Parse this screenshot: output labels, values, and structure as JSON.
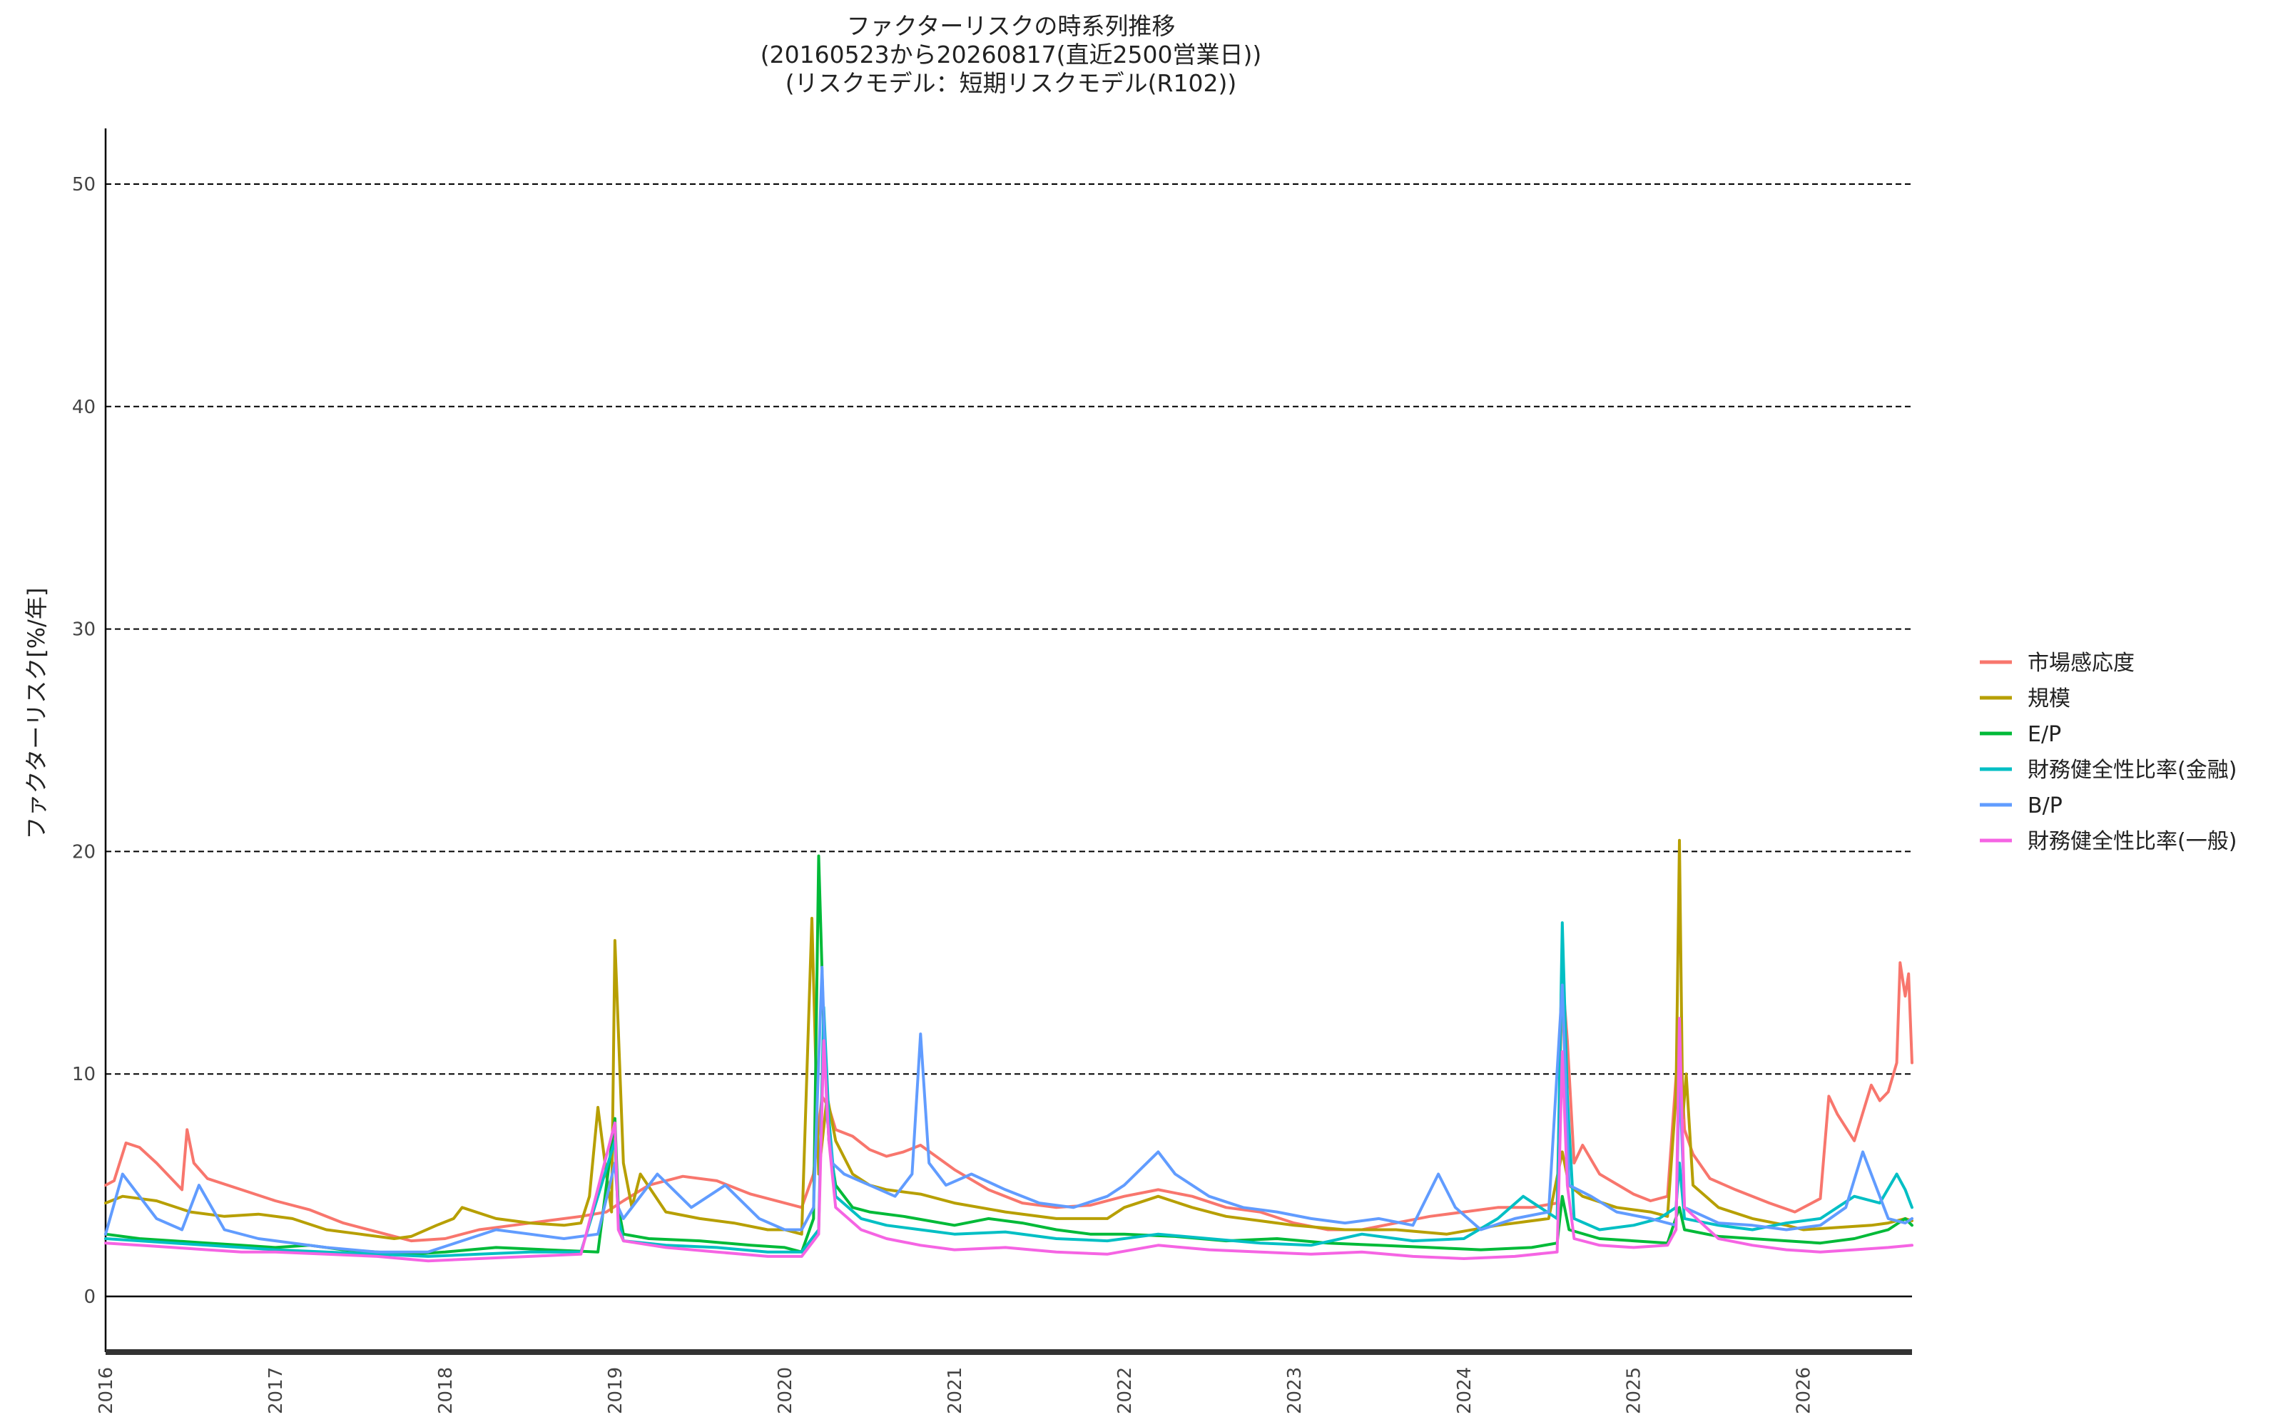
{
  "chart_data": {
    "type": "line",
    "title": [
      "ファクターリスクの時系列推移",
      "(20160523から20260817(直近2500営業日))",
      "(リスクモデル：短期リスクモデル(R102))"
    ],
    "ylabel": "ファクターリスク[%/年]",
    "xlabel": "",
    "xlim": [
      2016.0,
      2026.64
    ],
    "ylim": [
      -2.5,
      52.5
    ],
    "y_ticks": [
      0,
      10,
      20,
      30,
      40,
      50
    ],
    "x_ticks": [
      "2016",
      "2017",
      "2018",
      "2019",
      "2020",
      "2021",
      "2022",
      "2023",
      "2024",
      "2025",
      "2026"
    ],
    "grid": "horizontal dashed",
    "legend_position": "right",
    "series": [
      {
        "name": "市場感応度",
        "color": "#F8766D",
        "x": [
          2016.0,
          2016.05,
          2016.12,
          2016.2,
          2016.3,
          2016.45,
          2016.48,
          2016.52,
          2016.6,
          2016.8,
          2017.0,
          2017.2,
          2017.4,
          2017.6,
          2017.8,
          2018.0,
          2018.2,
          2018.4,
          2018.6,
          2018.8,
          2018.95,
          2019.05,
          2019.2,
          2019.4,
          2019.6,
          2019.8,
          2020.0,
          2020.1,
          2020.17,
          2020.22,
          2020.26,
          2020.3,
          2020.4,
          2020.5,
          2020.6,
          2020.7,
          2020.8,
          2021.0,
          2021.2,
          2021.4,
          2021.6,
          2021.8,
          2022.0,
          2022.2,
          2022.4,
          2022.6,
          2022.8,
          2023.0,
          2023.2,
          2023.4,
          2023.6,
          2023.8,
          2024.0,
          2024.2,
          2024.4,
          2024.55,
          2024.58,
          2024.61,
          2024.65,
          2024.7,
          2024.8,
          2025.0,
          2025.1,
          2025.2,
          2025.27,
          2025.3,
          2025.35,
          2025.45,
          2025.6,
          2025.8,
          2025.95,
          2026.1,
          2026.15,
          2026.2,
          2026.3,
          2026.4,
          2026.45,
          2026.5,
          2026.55,
          2026.57,
          2026.6,
          2026.62,
          2026.64
        ],
        "values": [
          5.0,
          5.2,
          6.9,
          6.7,
          6.0,
          4.8,
          7.5,
          6.0,
          5.3,
          4.8,
          4.3,
          3.9,
          3.3,
          2.9,
          2.5,
          2.6,
          3.0,
          3.2,
          3.4,
          3.6,
          3.8,
          4.3,
          5.0,
          5.4,
          5.2,
          4.6,
          4.2,
          4.0,
          5.5,
          9.0,
          8.5,
          7.5,
          7.2,
          6.6,
          6.3,
          6.5,
          6.8,
          5.7,
          4.8,
          4.2,
          4.0,
          4.1,
          4.5,
          4.8,
          4.5,
          4.0,
          3.8,
          3.3,
          3.0,
          3.0,
          3.3,
          3.6,
          3.8,
          4.0,
          4.0,
          4.2,
          14.5,
          11.5,
          6.0,
          6.8,
          5.5,
          4.6,
          4.3,
          4.5,
          12.0,
          7.5,
          6.4,
          5.3,
          4.8,
          4.2,
          3.8,
          4.4,
          9.0,
          8.2,
          7.0,
          9.5,
          8.8,
          9.2,
          10.5,
          15.0,
          13.5,
          14.5,
          10.5
        ]
      },
      {
        "name": "規模",
        "color": "#B79F00",
        "x": [
          2016.0,
          2016.1,
          2016.2,
          2016.3,
          2016.5,
          2016.7,
          2016.9,
          2017.1,
          2017.3,
          2017.5,
          2017.7,
          2017.8,
          2017.95,
          2018.05,
          2018.1,
          2018.3,
          2018.5,
          2018.7,
          2018.8,
          2018.85,
          2018.9,
          2018.95,
          2018.98,
          2019.0,
          2019.05,
          2019.1,
          2019.15,
          2019.3,
          2019.5,
          2019.7,
          2019.9,
          2020.0,
          2020.1,
          2020.16,
          2020.2,
          2020.25,
          2020.3,
          2020.4,
          2020.5,
          2020.6,
          2020.8,
          2021.0,
          2021.3,
          2021.6,
          2021.9,
          2022.0,
          2022.2,
          2022.4,
          2022.6,
          2022.8,
          2023.0,
          2023.3,
          2023.6,
          2023.9,
          2024.2,
          2024.5,
          2024.58,
          2024.62,
          2024.7,
          2024.9,
          2025.1,
          2025.2,
          2025.25,
          2025.27,
          2025.29,
          2025.31,
          2025.35,
          2025.5,
          2025.7,
          2025.9,
          2026.0,
          2026.2,
          2026.4,
          2026.5,
          2026.6,
          2026.64
        ],
        "values": [
          4.2,
          4.5,
          4.4,
          4.3,
          3.8,
          3.6,
          3.7,
          3.5,
          3.0,
          2.8,
          2.6,
          2.7,
          3.2,
          3.5,
          4.0,
          3.5,
          3.3,
          3.2,
          3.3,
          4.5,
          8.5,
          5.5,
          3.8,
          16.0,
          6.0,
          4.0,
          5.5,
          3.8,
          3.5,
          3.3,
          3.0,
          3.0,
          2.8,
          17.0,
          5.5,
          9.0,
          7.0,
          5.5,
          5.0,
          4.8,
          4.6,
          4.2,
          3.8,
          3.5,
          3.5,
          4.0,
          4.5,
          4.0,
          3.6,
          3.4,
          3.2,
          3.0,
          3.0,
          2.8,
          3.2,
          3.5,
          6.5,
          5.0,
          4.5,
          4.0,
          3.8,
          3.6,
          9.0,
          20.5,
          8.0,
          10.0,
          5.0,
          4.0,
          3.5,
          3.2,
          3.0,
          3.1,
          3.2,
          3.3,
          3.5,
          3.4
        ]
      },
      {
        "name": "E/P",
        "color": "#00BA38",
        "x": [
          2016.0,
          2016.2,
          2016.4,
          2016.6,
          2016.8,
          2017.0,
          2017.2,
          2017.4,
          2017.6,
          2017.8,
          2018.0,
          2018.3,
          2018.6,
          2018.9,
          2019.0,
          2019.02,
          2019.05,
          2019.2,
          2019.5,
          2019.8,
          2020.0,
          2020.1,
          2020.17,
          2020.2,
          2020.23,
          2020.26,
          2020.3,
          2020.4,
          2020.5,
          2020.7,
          2021.0,
          2021.2,
          2021.4,
          2021.6,
          2021.8,
          2022.0,
          2022.3,
          2022.6,
          2022.9,
          2023.2,
          2023.5,
          2023.8,
          2024.1,
          2024.4,
          2024.55,
          2024.58,
          2024.62,
          2024.8,
          2025.0,
          2025.2,
          2025.27,
          2025.3,
          2025.5,
          2025.7,
          2025.9,
          2026.1,
          2026.3,
          2026.5,
          2026.6,
          2026.64
        ],
        "values": [
          2.8,
          2.6,
          2.5,
          2.4,
          2.3,
          2.2,
          2.3,
          2.1,
          2.0,
          1.9,
          2.0,
          2.2,
          2.1,
          2.0,
          8.0,
          4.0,
          2.8,
          2.6,
          2.5,
          2.3,
          2.2,
          2.0,
          3.5,
          19.8,
          12.0,
          7.0,
          5.0,
          4.0,
          3.8,
          3.6,
          3.2,
          3.5,
          3.3,
          3.0,
          2.8,
          2.8,
          2.7,
          2.5,
          2.6,
          2.4,
          2.3,
          2.2,
          2.1,
          2.2,
          2.4,
          4.5,
          3.0,
          2.6,
          2.5,
          2.4,
          4.0,
          3.0,
          2.7,
          2.6,
          2.5,
          2.4,
          2.6,
          3.0,
          3.5,
          3.2
        ]
      },
      {
        "name": "財務健全性比率(金融)",
        "color": "#00BFC4",
        "x": [
          2016.0,
          2016.2,
          2016.4,
          2016.6,
          2016.8,
          2017.0,
          2017.3,
          2017.6,
          2017.9,
          2018.2,
          2018.5,
          2018.8,
          2019.0,
          2019.02,
          2019.05,
          2019.3,
          2019.6,
          2019.9,
          2020.1,
          2020.2,
          2020.23,
          2020.26,
          2020.3,
          2020.45,
          2020.6,
          2020.8,
          2021.0,
          2021.3,
          2021.6,
          2021.9,
          2022.2,
          2022.5,
          2022.8,
          2023.1,
          2023.4,
          2023.7,
          2024.0,
          2024.2,
          2024.35,
          2024.45,
          2024.55,
          2024.58,
          2024.61,
          2024.65,
          2024.8,
          2025.0,
          2025.15,
          2025.25,
          2025.27,
          2025.3,
          2025.5,
          2025.7,
          2025.9,
          2026.1,
          2026.3,
          2026.45,
          2026.55,
          2026.6,
          2026.64
        ],
        "values": [
          2.6,
          2.5,
          2.4,
          2.3,
          2.2,
          2.1,
          2.0,
          1.9,
          1.8,
          1.9,
          2.0,
          2.0,
          7.0,
          3.5,
          2.5,
          2.3,
          2.2,
          2.0,
          2.0,
          3.0,
          13.0,
          8.0,
          4.5,
          3.5,
          3.2,
          3.0,
          2.8,
          2.9,
          2.6,
          2.5,
          2.8,
          2.6,
          2.4,
          2.3,
          2.8,
          2.5,
          2.6,
          3.5,
          4.5,
          4.0,
          3.5,
          16.8,
          9.0,
          3.5,
          3.0,
          3.2,
          3.5,
          4.0,
          6.0,
          3.5,
          3.2,
          3.0,
          3.3,
          3.5,
          4.5,
          4.2,
          5.5,
          4.8,
          4.0
        ]
      },
      {
        "name": "B/P",
        "color": "#619CFF",
        "x": [
          2016.0,
          2016.1,
          2016.2,
          2016.3,
          2016.45,
          2016.55,
          2016.7,
          2016.9,
          2017.1,
          2017.3,
          2017.6,
          2017.9,
          2018.1,
          2018.3,
          2018.5,
          2018.7,
          2018.9,
          2019.0,
          2019.02,
          2019.05,
          2019.25,
          2019.45,
          2019.65,
          2019.85,
          2020.0,
          2020.1,
          2020.17,
          2020.22,
          2020.25,
          2020.28,
          2020.35,
          2020.5,
          2020.65,
          2020.75,
          2020.8,
          2020.85,
          2020.95,
          2021.1,
          2021.3,
          2021.5,
          2021.7,
          2021.9,
          2022.0,
          2022.2,
          2022.3,
          2022.5,
          2022.7,
          2022.9,
          2023.1,
          2023.3,
          2023.5,
          2023.7,
          2023.85,
          2023.95,
          2024.1,
          2024.3,
          2024.5,
          2024.58,
          2024.62,
          2024.75,
          2024.9,
          2025.1,
          2025.25,
          2025.27,
          2025.3,
          2025.5,
          2025.7,
          2025.9,
          2026.1,
          2026.25,
          2026.35,
          2026.5,
          2026.6,
          2026.64
        ],
        "values": [
          2.8,
          5.5,
          4.5,
          3.5,
          3.0,
          5.0,
          3.0,
          2.6,
          2.4,
          2.2,
          2.0,
          2.0,
          2.5,
          3.0,
          2.8,
          2.6,
          2.8,
          6.0,
          4.0,
          3.5,
          5.5,
          4.0,
          5.0,
          3.5,
          3.0,
          3.0,
          4.0,
          14.8,
          8.0,
          6.0,
          5.5,
          5.0,
          4.5,
          5.5,
          11.8,
          6.0,
          5.0,
          5.5,
          4.8,
          4.2,
          4.0,
          4.5,
          5.0,
          6.5,
          5.5,
          4.5,
          4.0,
          3.8,
          3.5,
          3.3,
          3.5,
          3.2,
          5.5,
          4.0,
          3.0,
          3.5,
          3.8,
          14.0,
          5.0,
          4.5,
          3.8,
          3.5,
          3.2,
          10.0,
          4.0,
          3.3,
          3.2,
          3.0,
          3.2,
          4.0,
          6.5,
          3.5,
          3.3,
          3.5
        ]
      },
      {
        "name": "財務健全性比率(一般)",
        "color": "#F564E3",
        "x": [
          2016.0,
          2016.2,
          2016.4,
          2016.6,
          2016.8,
          2017.0,
          2017.3,
          2017.6,
          2017.9,
          2018.2,
          2018.5,
          2018.8,
          2019.0,
          2019.02,
          2019.05,
          2019.3,
          2019.6,
          2019.9,
          2020.1,
          2020.2,
          2020.23,
          2020.26,
          2020.3,
          2020.45,
          2020.6,
          2020.8,
          2021.0,
          2021.3,
          2021.6,
          2021.9,
          2022.2,
          2022.5,
          2022.8,
          2023.1,
          2023.4,
          2023.7,
          2024.0,
          2024.3,
          2024.55,
          2024.58,
          2024.61,
          2024.65,
          2024.8,
          2025.0,
          2025.2,
          2025.25,
          2025.27,
          2025.3,
          2025.5,
          2025.7,
          2025.9,
          2026.1,
          2026.3,
          2026.5,
          2026.64
        ],
        "values": [
          2.4,
          2.3,
          2.2,
          2.1,
          2.0,
          2.0,
          1.9,
          1.8,
          1.6,
          1.7,
          1.8,
          1.9,
          7.8,
          3.0,
          2.5,
          2.2,
          2.0,
          1.8,
          1.8,
          2.8,
          11.5,
          7.0,
          4.0,
          3.0,
          2.6,
          2.3,
          2.1,
          2.2,
          2.0,
          1.9,
          2.3,
          2.1,
          2.0,
          1.9,
          2.0,
          1.8,
          1.7,
          1.8,
          2.0,
          11.0,
          5.0,
          2.6,
          2.3,
          2.2,
          2.3,
          3.0,
          12.5,
          4.0,
          2.6,
          2.3,
          2.1,
          2.0,
          2.1,
          2.2,
          2.3
        ]
      }
    ]
  }
}
